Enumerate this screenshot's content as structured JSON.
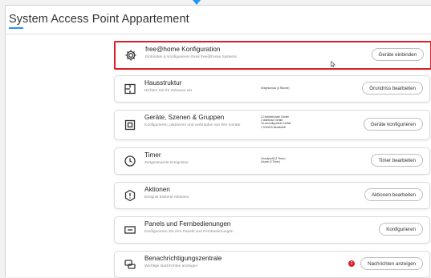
{
  "page": {
    "title": "System Access Point Appartement",
    "accent_color": "#2196f3",
    "highlight_color": "#d8202a"
  },
  "cards": [
    {
      "icon": "gear-icon",
      "title": "free@home Konfiguration",
      "subtitle": "Einbinden & Konfigurieren Ihres free@home Systems",
      "info": [],
      "button": "Geräte einbinden",
      "highlighted": true
    },
    {
      "icon": "floorplan-icon",
      "title": "Hausstruktur",
      "subtitle": "Richten Sie Ihr Zuhause ein",
      "info": [
        "Erdgeschoss (4 Räume)"
      ],
      "button": "Grundriss bearbeiten"
    },
    {
      "icon": "device-icon",
      "title": "Geräte, Szenen & Gruppen",
      "subtitle": "Konfigurieren, platzieren und verbrüpfen Sie Ihre Geräte",
      "info": [
        "12 bidirektionale Geräte",
        "2 drahtlose Geräte",
        "16 unkonfigurierte Geräte",
        "1 SONOS-Musikstoff"
      ],
      "button": "Geräte konfigurieren"
    },
    {
      "icon": "timer-icon",
      "title": "Timer",
      "subtitle": "Zeitgesteuerte Ereignisse",
      "info": [
        "Grundprofil (2 Timer)",
        "Urlaub (2 Timer)"
      ],
      "button": "Timer bearbeiten"
    },
    {
      "icon": "action-icon",
      "title": "Aktionen",
      "subtitle": "Ereignis basierte Aktionen",
      "info": [],
      "button": "Aktionen bearbeiten"
    },
    {
      "icon": "remote-panel-icon",
      "title": "Panels und Fernbedienungen",
      "subtitle": "Konfigurieren Sie Ihre Panels und Fernbedienungen",
      "info": [],
      "button": "Konfigurieren"
    },
    {
      "icon": "notification-icon",
      "title": "Benachrichtigungszentrale",
      "subtitle": "Wichtige Nachrichten anzeigen",
      "info": [],
      "badge": "2",
      "button": "Nachrichten anzeigen"
    }
  ]
}
